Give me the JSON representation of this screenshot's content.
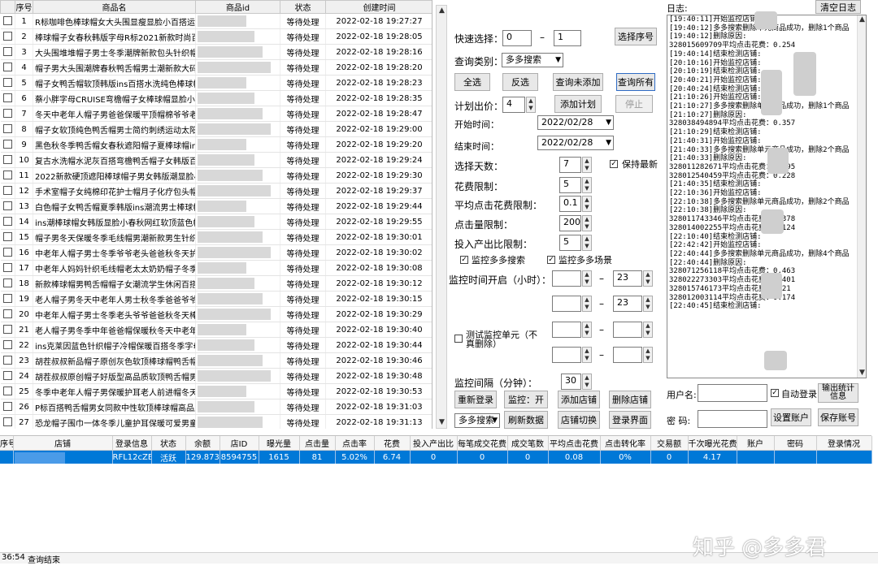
{
  "product_table": {
    "headers": [
      "序号",
      "商品名",
      "商品id",
      "状态",
      "创建时间"
    ],
    "rows": [
      {
        "n": "1",
        "name": "R标咖啡色棒球帽女大头围显瘦显脸小百搭运动",
        "status": "等待处理",
        "time": "2022-02-18 19:27:27"
      },
      {
        "n": "2",
        "name": "棒球帽子女春秋韩版字母R标2021新款时尚百",
        "status": "等待处理",
        "time": "2022-02-18 19:28:05"
      },
      {
        "n": "3",
        "name": "大头围堆堆帽子男士冬季潮牌新款包头针织帽",
        "status": "等待处理",
        "time": "2022-02-18 19:28:16"
      },
      {
        "n": "4",
        "name": "帽子男大头围潮牌春秋鸭舌帽男士潮新款大码",
        "status": "等待处理",
        "time": "2022-02-18 19:28:20"
      },
      {
        "n": "5",
        "name": "帽子女鸭舌帽软顶韩版ins百搭水洗纯色棒球帽",
        "status": "等待处理",
        "time": "2022-02-18 19:28:23"
      },
      {
        "n": "6",
        "name": "蔡小胖字母CRUISE弯檐帽子女棒球帽显脸小",
        "status": "等待处理",
        "time": "2022-02-18 19:28:35"
      },
      {
        "n": "7",
        "name": "冬天中老年人帽子男爸爸保暖平顶帽棉爷爷老",
        "status": "等待处理",
        "time": "2022-02-18 19:28:47"
      },
      {
        "n": "8",
        "name": "帽子女软顶纯色鸭舌帽男士简约刺绣运动太阳",
        "status": "等待处理",
        "time": "2022-02-18 19:29:00"
      },
      {
        "n": "9",
        "name": "黑色秋冬季鸭舌帽女春秋遮阳帽子夏棒球帽ins",
        "status": "等待处理",
        "time": "2022-02-18 19:29:20"
      },
      {
        "n": "10",
        "name": "复古水洗帽水泥灰百搭弯檐鸭舌帽子女韩版百",
        "status": "等待处理",
        "time": "2022-02-18 19:29:24"
      },
      {
        "n": "11",
        "name": "2022新款硬顶遮阳棒球帽子男女韩版潮显脸小",
        "status": "等待处理",
        "time": "2022-02-18 19:29:30"
      },
      {
        "n": "12",
        "name": "手术室帽子女纯棉印花护士帽月子化疗包头帽",
        "status": "等待处理",
        "time": "2022-02-18 19:29:37"
      },
      {
        "n": "13",
        "name": "白色帽子女鸭舌帽夏季韩版ins潮流男士棒球帽",
        "status": "等待处理",
        "time": "2022-02-18 19:29:44"
      },
      {
        "n": "14",
        "name": "ins潮棒球帽女韩版显脸小春秋网红软顶蓝色帽",
        "status": "等待处理",
        "time": "2022-02-18 19:29:55"
      },
      {
        "n": "15",
        "name": "帽子男冬天保暖冬季毛线帽男潮新款男生针织帽",
        "status": "等待处理",
        "time": "2022-02-18 19:30:01"
      },
      {
        "n": "16",
        "name": "中老年人帽子男士冬季爷爷老头爸爸秋冬天护",
        "status": "等待处理",
        "time": "2022-02-18 19:30:02"
      },
      {
        "n": "17",
        "name": "中老年人妈妈针织毛线帽老太太奶奶帽子冬季",
        "status": "等待处理",
        "time": "2022-02-18 19:30:08"
      },
      {
        "n": "18",
        "name": "新款棒球帽男鸭舌帽帽子女潮流学生休闲百搭",
        "status": "等待处理",
        "time": "2022-02-18 19:30:12"
      },
      {
        "n": "19",
        "name": "老人帽子男冬天中老年人男士秋冬季爸爸爷爷",
        "status": "等待处理",
        "time": "2022-02-18 19:30:15"
      },
      {
        "n": "20",
        "name": "中老年人帽子男士冬季老头爷爷爸爸秋冬天棒",
        "status": "等待处理",
        "time": "2022-02-18 19:30:29"
      },
      {
        "n": "21",
        "name": "老人帽子男冬季中年爸爸帽保暖秋冬天中老年",
        "status": "等待处理",
        "time": "2022-02-18 19:30:40"
      },
      {
        "n": "22",
        "name": "ins克莱因蓝色针织帽子冷帽保暖百搭冬季字母",
        "status": "等待处理",
        "time": "2022-02-18 19:30:44"
      },
      {
        "n": "23",
        "name": "胡茬叔叔新品帽子原创灰色软顶棒球帽鸭舌帽",
        "status": "等待处理",
        "time": "2022-02-18 19:30:46"
      },
      {
        "n": "24",
        "name": "胡茬叔叔原创帽子好版型高品质软顶鸭舌帽男",
        "status": "等待处理",
        "time": "2022-02-18 19:30:48"
      },
      {
        "n": "25",
        "name": "冬季中老年人帽子男保暖护耳老人前进帽冬天",
        "status": "等待处理",
        "time": "2022-02-18 19:30:53"
      },
      {
        "n": "26",
        "name": "P标百搭鸭舌帽男女同款中性软顶棒球帽高品质",
        "status": "等待处理",
        "time": "2022-02-18 19:31:03"
      },
      {
        "n": "27",
        "name": "恐龙帽子围巾一体冬季儿童护耳保暖可爱男童",
        "status": "等待处理",
        "time": "2022-02-18 19:31:13"
      }
    ]
  },
  "controls": {
    "quick_select_label": "快速选择：",
    "quick_from": "0",
    "quick_dash": "–",
    "quick_to": "1",
    "select_seq_button": "选择序号",
    "query_type_label": "查询类别：",
    "query_type_value": "多多搜索",
    "select_all": "全选",
    "invert": "反选",
    "query_unadded": "查询未添加",
    "query_all": "查询所有",
    "plan_bid_label": "计划出价：",
    "plan_bid_value": "4",
    "add_plan": "添加计划",
    "stop": "停止",
    "start_time_label": "开始时间：",
    "start_time_value": "2022/02/28",
    "end_time_label": "结束时间：",
    "end_time_value": "2022/02/28",
    "days_label": "选择天数：",
    "days_value": "7",
    "keep_latest": "保持最新",
    "spend_limit_label": "花费限制：",
    "spend_limit_value": "5",
    "avg_click_label": "平均点击花费限制：",
    "avg_click_value": "0.1",
    "click_limit_label": "点击量限制：",
    "click_limit_value": "200",
    "roi_limit_label": "投入产出比限制：",
    "roi_limit_value": "5",
    "monitor_search": "监控多多搜索",
    "monitor_scene": "监控多多场景",
    "monitor_time_label": "监控时间开启（小时）：",
    "monitor_t1_end": "23",
    "monitor_t2_end": "23",
    "dash": "–",
    "test_monitor": "测试监控单元（不真删除）",
    "interval_label": "监控间隔（分钟）：",
    "interval_value": "30",
    "relogin": "重新登录",
    "monitor_on": "监控：开",
    "add_shop": "添加店铺",
    "delete_shop": "删除店铺",
    "bottom_select": "多多搜索",
    "refresh_data": "刷新数据",
    "switch_shop": "店铺切换",
    "login_page": "登录界面"
  },
  "log": {
    "label": "日志:",
    "clear_button": "清空日志",
    "lines": [
      "[19:40:11]开始监控店铺:",
      "[19:40:12]多多搜索删除单元商品成功，删除1个商品",
      "[19:40:12]删除原因:",
      "328015609709平均点击花费：0.254",
      "[19:40:14]结束检测店铺:",
      "[20:10:16]开始监控店铺:",
      "[20:10:19]结束检测店铺:",
      "[20:40:21]开始监控店铺:",
      "[20:40:24]结束检测店铺:",
      "[21:10:26]开始监控店铺:",
      "[21:10:27]多多搜索删除单元商品成功，删除1个商品",
      "[21:10:27]删除原因:",
      "328038494894平均点击花费：0.357",
      "[21:10:29]结束检测店铺:",
      "[21:40:31]开始监控店铺:",
      "[21:40:33]多多搜索删除单元商品成功，删除2个商品",
      "[21:40:33]删除原因:",
      "328011282671平均点击花费：0.495",
      "328012540459平均点击花费：0.228",
      "[21:40:35]结束检测店铺:",
      "[22:10:36]开始监控店铺:",
      "[22:10:38]多多搜索删除单元商品成功，删除2个商品",
      "[22:10:38]删除原因:",
      "328011743346平均点击花费：0.378",
      "328014002255平均点击花费：0.124",
      "[22:10:40]结束检测店铺:",
      "[22:42:42]开始监控店铺:",
      "[22:40:44]多多搜索删除单元商品成功，删除4个商品",
      "[22:40:44]删除原因:",
      "328071256118平均点击花费：0.463",
      "328022273303平均点击花费：0.401",
      "328015746173平均点击花费：0.21",
      "328012003114平均点击花费：0.174",
      "[22:40:45]结束检测店铺:"
    ]
  },
  "account": {
    "username_label": "用户名:",
    "auto_login": "自动登录",
    "export_stats": "输出统计信息",
    "password_label": "密  码:",
    "set_account": "设置账户",
    "save_account": "保存账号"
  },
  "shop_table": {
    "headers": [
      "序号",
      "店铺",
      "登录信息",
      "状态",
      "余额",
      "店ID",
      "曝光量",
      "点击量",
      "点击率",
      "花费",
      "投入产出比",
      "每笔成交花费",
      "成交笔数",
      "平均点击花费",
      "点击转化率",
      "交易额",
      "千次曝光花费",
      "账户",
      "密码",
      "登录情况"
    ],
    "row": [
      "",
      "",
      "RFL12cZE",
      "活跃",
      "129.873",
      "8594755",
      "1615",
      "81",
      "5.02%",
      "6.74",
      "0",
      "0",
      "0",
      "0.08",
      "0%",
      "0",
      "4.17",
      "",
      "",
      ""
    ]
  },
  "status_bar": {
    "time": "36:54",
    "message": "查询结束"
  },
  "watermark": "知乎 @多多君"
}
